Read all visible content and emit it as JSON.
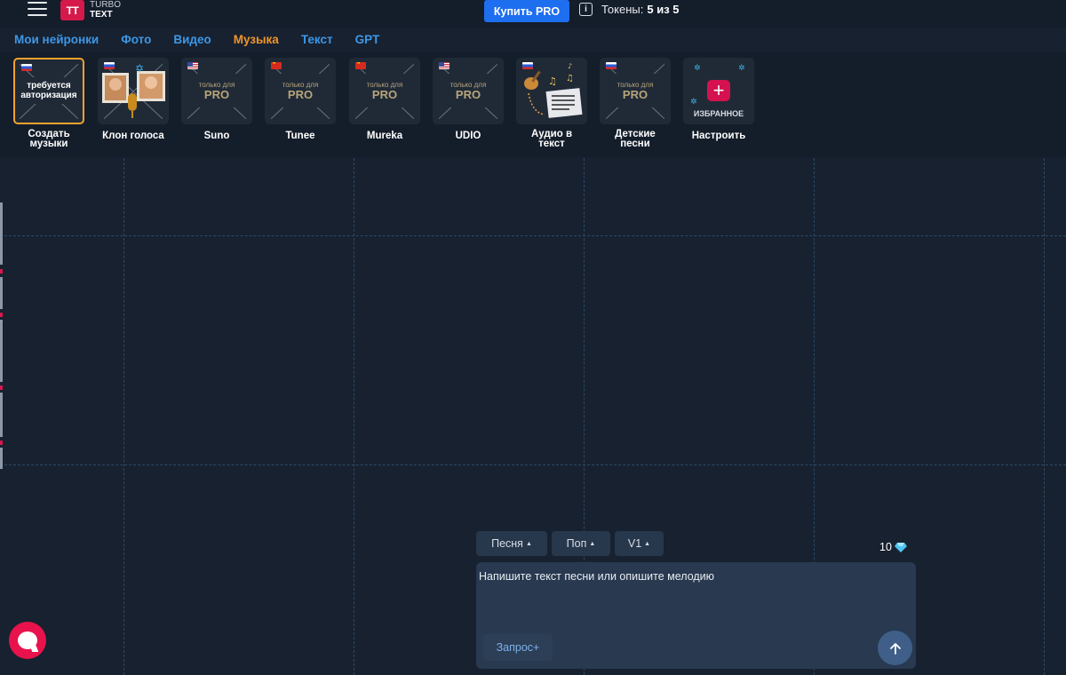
{
  "header": {
    "logo_mark": "TT",
    "logo_line1": "TURBO",
    "logo_line2": "TEXT",
    "buy_label": "Купить PRO",
    "tokens_label": "Токены:",
    "tokens_value": "5 из 5",
    "info_icon": "i"
  },
  "tabs": [
    {
      "label": "Мои нейронки",
      "active": false
    },
    {
      "label": "Фото",
      "active": false
    },
    {
      "label": "Видео",
      "active": false
    },
    {
      "label": "Музыка",
      "active": true
    },
    {
      "label": "Текст",
      "active": false
    },
    {
      "label": "GPT",
      "active": false
    }
  ],
  "tools": [
    {
      "label_1": "Создать",
      "label_2": "музыки",
      "flag": "ru",
      "overlay_1": "требуется",
      "overlay_2": "авторизация",
      "selected": true
    },
    {
      "label_1": "Клон голоса",
      "flag": "ru",
      "icon": "voice-clone-icon"
    },
    {
      "label_1": "Suno",
      "flag": "us",
      "pro_small": "только для",
      "pro_big": "PRO"
    },
    {
      "label_1": "Tunee",
      "flag": "cn",
      "pro_small": "только для",
      "pro_big": "PRO"
    },
    {
      "label_1": "Mureka",
      "flag": "cn",
      "pro_small": "только для",
      "pro_big": "PRO"
    },
    {
      "label_1": "UDIO",
      "flag": "us",
      "pro_small": "только для",
      "pro_big": "PRO"
    },
    {
      "label_1": "Аудио в",
      "label_2": "текст",
      "flag": "ru",
      "icon": "audio-to-text-icon"
    },
    {
      "label_1": "Детские",
      "label_2": "песни",
      "flag": "ru",
      "pro_small": "только для",
      "pro_big": "PRO"
    },
    {
      "label_1": "Настроить",
      "overlay_text": "ИЗБРАННОЕ",
      "plus": "+"
    }
  ],
  "composer": {
    "pills": [
      {
        "label": "Песня"
      },
      {
        "label": "Поп"
      },
      {
        "label": "V1"
      }
    ],
    "cost": "10",
    "placeholder": "Напишите текст песни или опишите мелодию",
    "request_label": "Запрос+",
    "send_icon": "arrow-up-icon"
  },
  "colors": {
    "accent_blue": "#1e6ef0",
    "tab_blue": "#3d97e6",
    "tab_active": "#f0952a",
    "brand_red": "#d6194b",
    "selected_border": "#f0a22c"
  }
}
